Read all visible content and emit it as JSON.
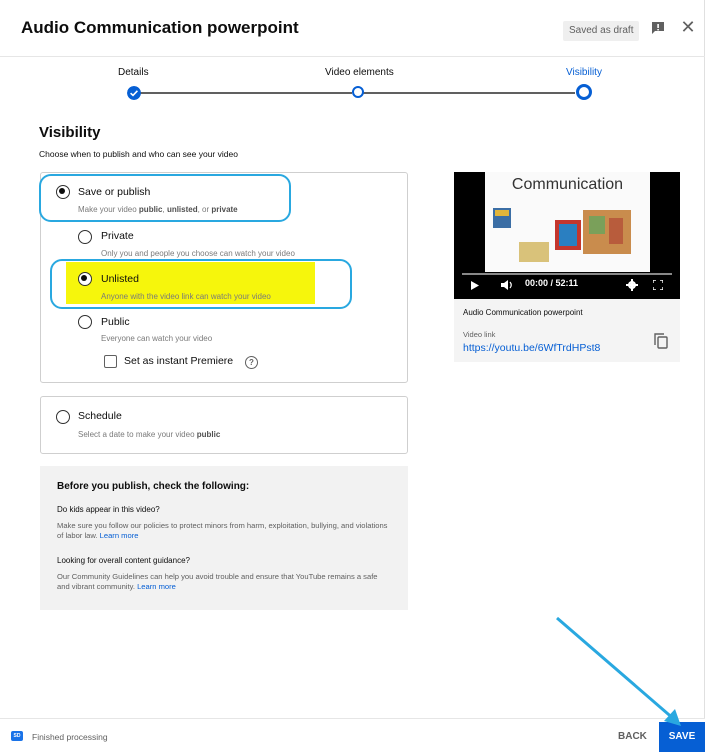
{
  "header": {
    "title": "Audio Communication powerpoint",
    "draft_label": "Saved as draft",
    "feedback_icon": "feedback-icon",
    "close_glyph": "✕"
  },
  "stepper": {
    "steps": [
      {
        "label": "Details",
        "state": "completed"
      },
      {
        "label": "Video elements",
        "state": "pending"
      },
      {
        "label": "Visibility",
        "state": "current"
      }
    ]
  },
  "visibility": {
    "title": "Visibility",
    "subtitle": "Choose when to publish and who can see your video",
    "save_or_publish": {
      "label": "Save or publish",
      "desc_prefix": "Make your video ",
      "desc_public": "public",
      "desc_sep1": ", ",
      "desc_unlisted": "unlisted",
      "desc_sep2": ", or ",
      "desc_private": "private",
      "selected": true
    },
    "options": [
      {
        "label": "Private",
        "desc": "Only you and people you choose can watch your video",
        "selected": false
      },
      {
        "label": "Unlisted",
        "desc": "Anyone with the video link can watch your video",
        "selected": true
      },
      {
        "label": "Public",
        "desc": "Everyone can watch your video",
        "selected": false
      }
    ],
    "premiere_label": "Set as instant Premiere",
    "help_glyph": "?",
    "schedule": {
      "label": "Schedule",
      "desc_prefix": "Select a date to make your video ",
      "desc_bold": "public",
      "selected": false
    }
  },
  "checklist": {
    "title": "Before you publish, check the following:",
    "q1": "Do kids appear in this video?",
    "t1": "Make sure you follow our policies to protect minors from harm, exploitation, bullying, and violations of labor law. ",
    "q2": "Looking for overall content guidance?",
    "t2": "Our Community Guidelines can help you avoid trouble and ensure that YouTube remains a safe and vibrant community. ",
    "learn_more": "Learn more"
  },
  "video": {
    "slide_title": "Communication",
    "time": "00:00 / 52:11",
    "name": "Audio Communication powerpoint",
    "link_label": "Video link",
    "link": "https://youtu.be/6WfTrdHPst8"
  },
  "footer": {
    "hd_badge": "SD",
    "status": "Finished processing",
    "back_label": "BACK",
    "save_label": "SAVE"
  },
  "colors": {
    "accent": "#065fd4",
    "highlight": "#f6f60c",
    "callout": "#29a8e0"
  }
}
